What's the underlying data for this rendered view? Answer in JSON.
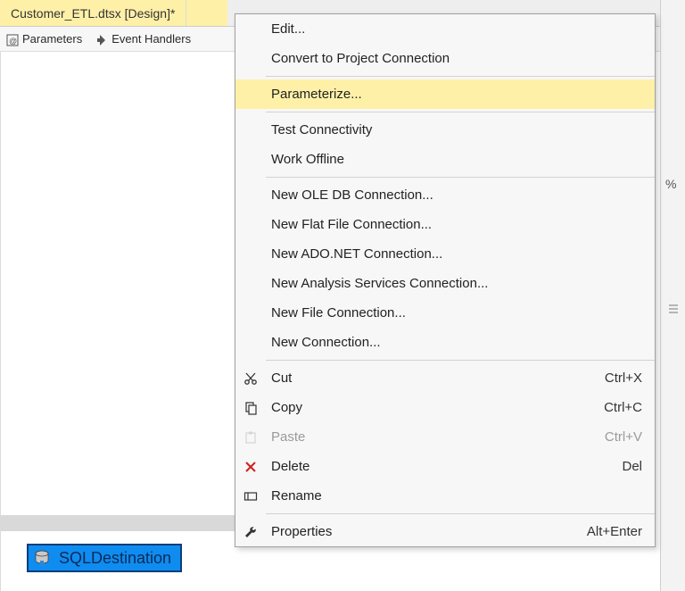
{
  "tab": {
    "title": "Customer_ETL.dtsx [Design]*"
  },
  "toolbar": {
    "parameters_label": "Parameters",
    "event_handlers_label": "Event Handlers"
  },
  "right_gutter": {
    "symbol": "%"
  },
  "object": {
    "label": "SQLDestination"
  },
  "context_menu": {
    "items": [
      {
        "label": "Edit...",
        "icon": null,
        "shortcut": "",
        "enabled": true,
        "highlighted": false
      },
      {
        "label": "Convert to Project Connection",
        "icon": null,
        "shortcut": "",
        "enabled": true,
        "highlighted": false
      },
      {
        "sep": true
      },
      {
        "label": "Parameterize...",
        "icon": null,
        "shortcut": "",
        "enabled": true,
        "highlighted": true
      },
      {
        "sep": true
      },
      {
        "label": "Test Connectivity",
        "icon": null,
        "shortcut": "",
        "enabled": true,
        "highlighted": false
      },
      {
        "label": "Work Offline",
        "icon": null,
        "shortcut": "",
        "enabled": true,
        "highlighted": false
      },
      {
        "sep": true
      },
      {
        "label": "New OLE DB Connection...",
        "icon": null,
        "shortcut": "",
        "enabled": true,
        "highlighted": false
      },
      {
        "label": "New Flat File Connection...",
        "icon": null,
        "shortcut": "",
        "enabled": true,
        "highlighted": false
      },
      {
        "label": "New ADO.NET Connection...",
        "icon": null,
        "shortcut": "",
        "enabled": true,
        "highlighted": false
      },
      {
        "label": "New Analysis Services Connection...",
        "icon": null,
        "shortcut": "",
        "enabled": true,
        "highlighted": false
      },
      {
        "label": "New File Connection...",
        "icon": null,
        "shortcut": "",
        "enabled": true,
        "highlighted": false
      },
      {
        "label": "New Connection...",
        "icon": null,
        "shortcut": "",
        "enabled": true,
        "highlighted": false
      },
      {
        "sep": true
      },
      {
        "label": "Cut",
        "icon": "cut",
        "shortcut": "Ctrl+X",
        "enabled": true,
        "highlighted": false
      },
      {
        "label": "Copy",
        "icon": "copy",
        "shortcut": "Ctrl+C",
        "enabled": true,
        "highlighted": false
      },
      {
        "label": "Paste",
        "icon": "paste",
        "shortcut": "Ctrl+V",
        "enabled": false,
        "highlighted": false
      },
      {
        "label": "Delete",
        "icon": "delete",
        "shortcut": "Del",
        "enabled": true,
        "highlighted": false
      },
      {
        "label": "Rename",
        "icon": "rename",
        "shortcut": "",
        "enabled": true,
        "highlighted": false
      },
      {
        "sep": true
      },
      {
        "label": "Properties",
        "icon": "wrench",
        "shortcut": "Alt+Enter",
        "enabled": true,
        "highlighted": false
      }
    ]
  }
}
